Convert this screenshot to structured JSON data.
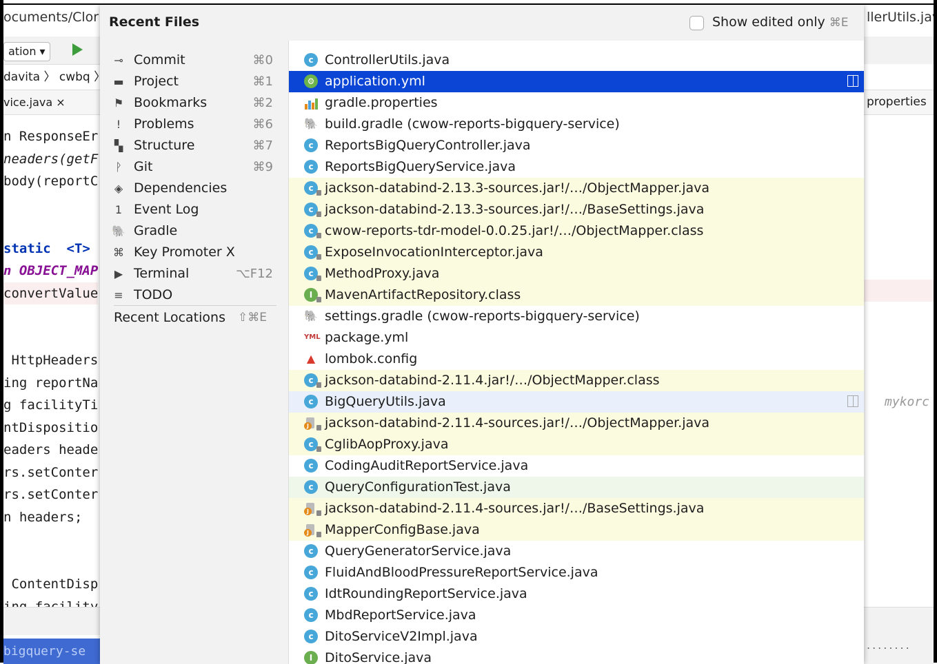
{
  "background": {
    "left_title": "ocuments/Clor",
    "run_config": "ation",
    "breadcrumb": "davita 〉 cwbq 〉",
    "tab_file": "vice.java ×",
    "code_lines": [
      "n ResponseEr",
      "neaders(getF",
      "body(reportC",
      "",
      "",
      "static  <T>",
      "n OBJECT_MAP",
      "convertValue",
      "",
      "",
      " HttpHeaders",
      "ing reportNa",
      "g facilityTi",
      "ntDispositio",
      "eaders heade",
      "rs.setConter",
      "rs.setConter",
      "n headers;",
      "",
      "",
      " ContentDisp",
      "ing facility"
    ],
    "status_text": "bigquery-se",
    "right_title": "llerUtils.jav",
    "right_tab": "properties",
    "right_hint": "mykorc",
    "right_dots": "........"
  },
  "popup": {
    "title": "Recent Files",
    "show_edited_label": "Show edited only",
    "show_edited_shortcut": "⌘E",
    "show_edited_checked": false,
    "nav": [
      {
        "icon": "commit-icon",
        "glyph": "⊸",
        "label": "Commit",
        "shortcut": "⌘0"
      },
      {
        "icon": "project-icon",
        "glyph": "▬",
        "label": "Project",
        "shortcut": "⌘1"
      },
      {
        "icon": "bookmark-icon",
        "glyph": "⚑",
        "label": "Bookmarks",
        "shortcut": "⌘2"
      },
      {
        "icon": "problems-icon",
        "glyph": "!",
        "label": "Problems",
        "shortcut": "⌘6"
      },
      {
        "icon": "structure-icon",
        "glyph": "▚",
        "label": "Structure",
        "shortcut": "⌘7"
      },
      {
        "icon": "git-icon",
        "glyph": "ᚹ",
        "label": "Git",
        "shortcut": "⌘9"
      },
      {
        "icon": "dependencies-icon",
        "glyph": "◈",
        "label": "Dependencies",
        "shortcut": ""
      },
      {
        "icon": "event-log-icon",
        "glyph": "1",
        "label": "Event Log",
        "shortcut": ""
      },
      {
        "icon": "gradle-icon",
        "glyph": "🐘",
        "label": "Gradle",
        "shortcut": ""
      },
      {
        "icon": "key-promoter-icon",
        "glyph": "⌘",
        "label": "Key Promoter X",
        "shortcut": ""
      },
      {
        "icon": "terminal-icon",
        "glyph": "▶",
        "label": "Terminal",
        "shortcut": "⌥F12"
      },
      {
        "icon": "todo-icon",
        "glyph": "≡",
        "label": "TODO",
        "shortcut": ""
      }
    ],
    "recent_locations_label": "Recent Locations",
    "recent_locations_shortcut": "⇧⌘E",
    "files": [
      {
        "name": "ControllerUtils.java",
        "icon": "class-icon",
        "style": ""
      },
      {
        "name": "application.yml",
        "icon": "spring-config-icon",
        "style": "sel"
      },
      {
        "name": "gradle.properties",
        "icon": "properties-icon",
        "style": ""
      },
      {
        "name": "build.gradle (cwow-reports-bigquery-service)",
        "icon": "gradle-file-icon",
        "style": ""
      },
      {
        "name": "ReportsBigQueryController.java",
        "icon": "class-icon",
        "style": ""
      },
      {
        "name": "ReportsBigQueryService.java",
        "icon": "class-icon",
        "style": ""
      },
      {
        "name": "jackson-databind-2.13.3-sources.jar!/…/ObjectMapper.java",
        "icon": "class-locked-icon",
        "style": "yellow"
      },
      {
        "name": "jackson-databind-2.13.3-sources.jar!/…/BaseSettings.java",
        "icon": "class-locked-icon",
        "style": "yellow"
      },
      {
        "name": "cwow-reports-tdr-model-0.0.25.jar!/…/ObjectMapper.class",
        "icon": "class-locked-icon",
        "style": "yellow"
      },
      {
        "name": "ExposeInvocationInterceptor.java",
        "icon": "class-locked-icon",
        "style": "yellow"
      },
      {
        "name": "MethodProxy.java",
        "icon": "class-locked-icon",
        "style": "yellow"
      },
      {
        "name": "MavenArtifactRepository.class",
        "icon": "interface-locked-icon",
        "style": "yellow"
      },
      {
        "name": "settings.gradle (cwow-reports-bigquery-service)",
        "icon": "gradle-file-icon",
        "style": ""
      },
      {
        "name": "package.yml",
        "icon": "yml-icon",
        "style": ""
      },
      {
        "name": "lombok.config",
        "icon": "lombok-icon",
        "style": ""
      },
      {
        "name": "jackson-databind-2.11.4.jar!/…/ObjectMapper.class",
        "icon": "class-locked-icon",
        "style": "yellow"
      },
      {
        "name": "BigQueryUtils.java",
        "icon": "class-icon",
        "style": "hover"
      },
      {
        "name": "jackson-databind-2.11.4-sources.jar!/…/ObjectMapper.java",
        "icon": "java-source-locked-icon",
        "style": "yellow"
      },
      {
        "name": "CglibAopProxy.java",
        "icon": "class-locked-icon",
        "style": "yellow"
      },
      {
        "name": "CodingAuditReportService.java",
        "icon": "class-icon",
        "style": ""
      },
      {
        "name": "QueryConfigurationTest.java",
        "icon": "test-class-icon",
        "style": "green"
      },
      {
        "name": "jackson-databind-2.11.4-sources.jar!/…/BaseSettings.java",
        "icon": "java-source-locked-icon",
        "style": "yellow"
      },
      {
        "name": "MapperConfigBase.java",
        "icon": "java-source-locked-icon",
        "style": "yellow"
      },
      {
        "name": "QueryGeneratorService.java",
        "icon": "class-icon",
        "style": ""
      },
      {
        "name": "FluidAndBloodPressureReportService.java",
        "icon": "class-icon",
        "style": ""
      },
      {
        "name": "IdtRoundingReportService.java",
        "icon": "class-icon",
        "style": ""
      },
      {
        "name": "MbdReportService.java",
        "icon": "class-icon",
        "style": ""
      },
      {
        "name": "DitoServiceV2Impl.java",
        "icon": "class-icon",
        "style": ""
      },
      {
        "name": "DitoService.java",
        "icon": "interface-icon",
        "style": ""
      }
    ]
  },
  "colors": {
    "selection": "#0a45d6",
    "library_row": "#fbfbe0",
    "test_row": "#eff7ea",
    "hover_row": "#e9f0fb"
  }
}
